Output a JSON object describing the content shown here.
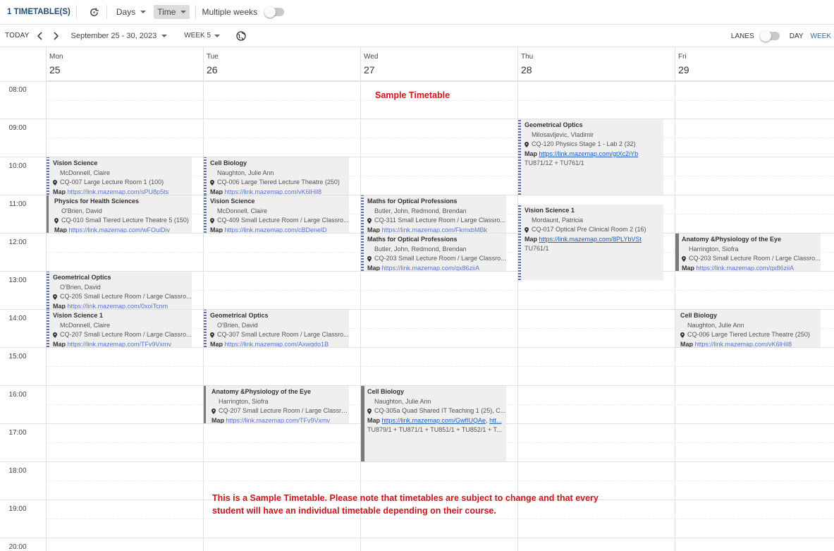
{
  "toolbar": {
    "title": "1 TIMETABLE(S)",
    "days_label": "Days",
    "time_label": "Time",
    "multiple_weeks_label": "Multiple weeks"
  },
  "nav": {
    "today_label": "TODAY",
    "date_range": "September 25 - 30, 2023",
    "week_label": "WEEK 5",
    "lanes_label": "LANES",
    "day_view_label": "DAY",
    "week_view_label": "WEEK"
  },
  "days": [
    {
      "name": "Mon",
      "date": "25"
    },
    {
      "name": "Tue",
      "date": "26"
    },
    {
      "name": "Wed",
      "date": "27"
    },
    {
      "name": "Thu",
      "date": "28"
    },
    {
      "name": "Fri",
      "date": "29"
    }
  ],
  "times": [
    "08:00",
    "09:00",
    "10:00",
    "11:00",
    "12:00",
    "13:00",
    "14:00",
    "15:00",
    "16:00",
    "17:00",
    "18:00",
    "19:00",
    "20:00"
  ],
  "events": {
    "mon_vision": {
      "title": "Vision Science",
      "lecturer": "McDonnell, Claire",
      "location": "CQ-007 Large Lecture Room 1 (100)",
      "map_label": "Map",
      "map_url": "https://link.mazemap.com/sPU8p5ts"
    },
    "mon_physics": {
      "title": "Physics for Health Sciences",
      "lecturer": "O'Brien, David",
      "location": "CQ-010 Small Tiered Lecture Theatre 5 (150)",
      "map_label": "Map",
      "map_url": "https://link.mazemap.com/wFOuiDiv"
    },
    "mon_geo": {
      "title": "Geometrical Optics",
      "lecturer": "O'Brien, David",
      "location": "CQ-205 Small Lecture Room / Large Classro...",
      "map_label": "Map",
      "map_url": "https://link.mazemap.com/0xoiTcnm"
    },
    "mon_vision1": {
      "title": "Vision Science 1",
      "lecturer": "McDonnell, Claire",
      "location": "CQ-207 Small Lecture Room / Large Classro...",
      "map_label": "Map",
      "map_url": "https://link.mazemap.com/TFv9Vxmv"
    },
    "tue_cell": {
      "title": "Cell Biology",
      "lecturer": "Naughton, Julie Ann",
      "location": "CQ-006 Large Tiered Lecture Theatre (250)",
      "map_label": "Map",
      "map_url": "https://link.mazemap.com/vK6lHil8"
    },
    "tue_vision": {
      "title": "Vision Science",
      "lecturer": "McDonnell, Claire",
      "location": "CQ-409 Small Lecture Room / Large Classro...",
      "map_label": "Map",
      "map_url": "https://link.mazemap.com/cBDenelD"
    },
    "tue_geo": {
      "title": "Geometrical Optics",
      "lecturer": "O'Brien, David",
      "location": "CQ-307 Small Lecture Room / Large Classro...",
      "map_label": "Map",
      "map_url": "https://link.mazemap.com/Axwgdo1B"
    },
    "tue_anat": {
      "title": "Anatomy &Physiology of the Eye",
      "lecturer": "Harrington, Siofra",
      "location": "CQ-207 Small Lecture Room / Large Classro...",
      "map_label": "Map",
      "map_url": "https://link.mazemap.com/TFv9Vxmv"
    },
    "wed_maths1": {
      "title": "Maths for Optical Professions",
      "lecturer": "Butler, John, Redmond, Brendan",
      "location": "CQ-311 Small Lecture Room / Large Classro...",
      "map_label": "Map",
      "map_url": "https://link.mazemap.com/FkmxbMBk"
    },
    "wed_maths2": {
      "title": "Maths for Optical Professions",
      "lecturer": "Butler, John, Redmond, Brendan",
      "location": "CQ-203 Small Lecture Room / Large Classro...",
      "map_label": "Map",
      "map_url": "https://link.mazemap.com/qx86ziiA"
    },
    "wed_cell": {
      "title": "Cell Biology",
      "lecturer": "Naughton, Julie Ann",
      "location": "CQ-305a Quad Shared IT Teaching 1 (25), C...",
      "map_label": "Map",
      "map_url": "https://link.mazemap.com/GwfIUQAe",
      "map_url2": "htt...",
      "groups": "TU879/1 + TU871/1 + TU851/1 + TU852/1 + T..."
    },
    "thu_geo": {
      "title": "Geometrical Optics",
      "lecturer": "Milosavljevic, Vladimir",
      "location": "CQ-120 Physics Stage 1 - Lab 2 (32)",
      "map_label": "Map",
      "map_url": "https://link.mazemap.com/gtXc2iYb",
      "groups": "TU871/1Z + TU761/1"
    },
    "thu_vision1": {
      "title": "Vision Science 1",
      "lecturer": "Mordaunt, Patricia",
      "location": "CQ-017 Optical Pre Clinical Room 2 (16)",
      "map_label": "Map",
      "map_url": "https://link.mazemap.com/8PLYbVSt",
      "groups": "TU761/1"
    },
    "fri_anat": {
      "title": "Anatomy &Physiology of the Eye",
      "lecturer": "Harrington, Siofra",
      "location": "CQ-203 Small Lecture Room / Large Classro...",
      "map_label": "Map",
      "map_url": "https://link.mazemap.com/qx86ziiA"
    },
    "fri_cell": {
      "title": "Cell Biology",
      "lecturer": "Naughton, Julie Ann",
      "location": "CQ-006 Large Tiered Lecture Theatre (250)",
      "map_label": "Map",
      "map_url": "https://link.mazemap.com/vK6lHil8"
    }
  },
  "annotations": {
    "sample_title": "Sample Timetable",
    "note_line1": "This is a Sample Timetable. Please note that timetables are subject to change and that every",
    "note_line2": "student will have an individual timetable depending on their course."
  },
  "colors": {
    "accent": "#1f6db3",
    "title": "#1f4e79",
    "annotation_red": "#d0121b",
    "event_bg": "#efefef",
    "stripe": "#5d6ab5"
  }
}
